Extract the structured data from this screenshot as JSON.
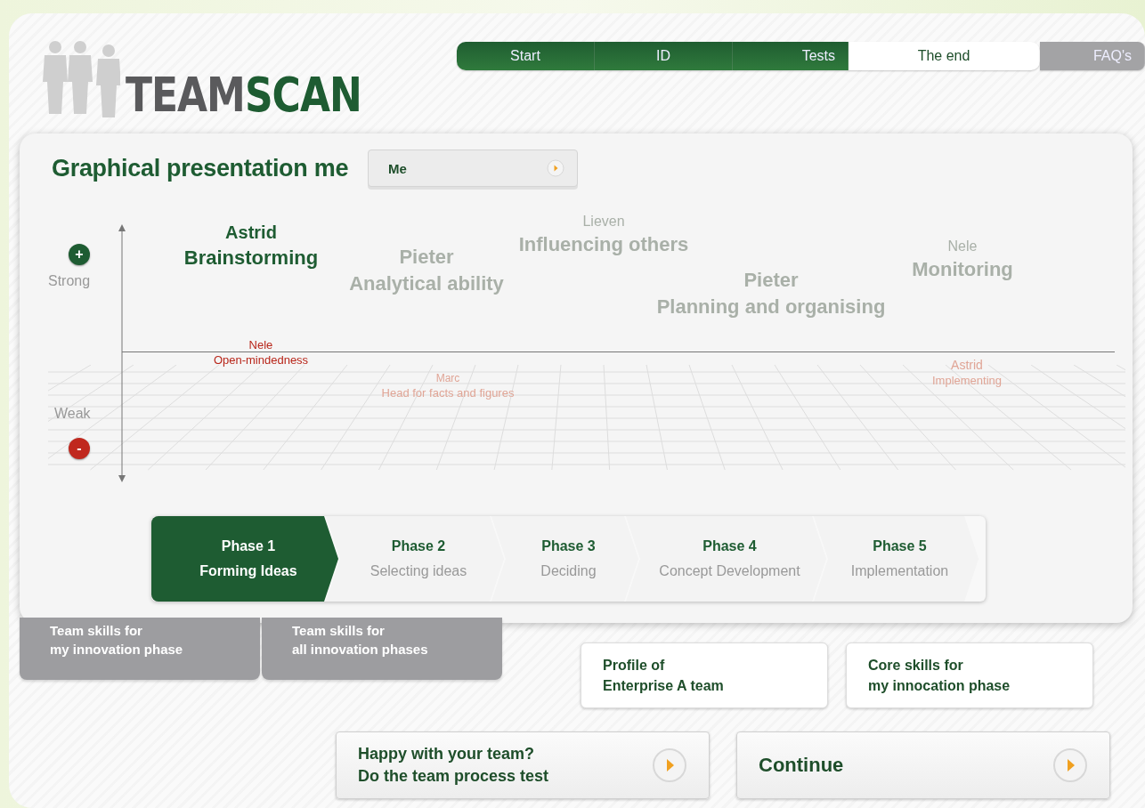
{
  "logo": {
    "text": "TEAMSCAN"
  },
  "nav": [
    {
      "label": "Start",
      "kind": "step",
      "done": true,
      "selected": false
    },
    {
      "label": "ID",
      "kind": "step",
      "done": true,
      "selected": false
    },
    {
      "label": "Tests",
      "kind": "step",
      "done": true,
      "selected": false
    },
    {
      "label": "The end",
      "kind": "step",
      "done": false,
      "selected": true
    },
    {
      "label": "FAQ's",
      "kind": "help",
      "done": false,
      "selected": false
    }
  ],
  "panel": {
    "title": "Graphical presentation me",
    "selector": {
      "value": "Me"
    }
  },
  "axis": {
    "strong_label": "Strong",
    "plus": "+",
    "weak_label": "Weak",
    "minus": "-"
  },
  "skills": [
    {
      "person": "Astrid",
      "skill": "Brainstorming",
      "kind": "strong",
      "highlighted": true
    },
    {
      "person": "Pieter",
      "skill": "Analytical ability",
      "kind": "strong",
      "highlighted": false
    },
    {
      "person": "Lieven",
      "skill": "Influencing others",
      "kind": "strong",
      "highlighted": false
    },
    {
      "person": "Pieter",
      "skill": "Planning and organising",
      "kind": "strong",
      "highlighted": false
    },
    {
      "person": "Nele",
      "skill": "Monitoring",
      "kind": "strong",
      "highlighted": false
    },
    {
      "person": "Nele",
      "skill": "Open-mindedness",
      "kind": "weak",
      "highlighted": true
    },
    {
      "person": "Marc",
      "skill": "Head for facts and figures",
      "kind": "weak",
      "highlighted": false
    },
    {
      "person": "Astrid",
      "skill": "Implementing",
      "kind": "weak",
      "highlighted": false
    }
  ],
  "phases": [
    {
      "number": "Phase 1",
      "name": "Forming Ideas",
      "selected": true
    },
    {
      "number": "Phase 2",
      "name": "Selecting ideas",
      "selected": false
    },
    {
      "number": "Phase 3",
      "name": "Deciding",
      "selected": false
    },
    {
      "number": "Phase 4",
      "name": "Concept Development",
      "selected": false
    },
    {
      "number": "Phase 5",
      "name": "Implementation",
      "selected": false
    }
  ],
  "tabs": [
    {
      "line1": "Team skills for",
      "line2": "my innovation phase",
      "disabled": true
    },
    {
      "line1": "Team skills for",
      "line2": "all innovation phases",
      "disabled": true
    }
  ],
  "options": [
    {
      "line1": "Profile of",
      "line2": "Enterprise A team"
    },
    {
      "line1": "Core skills for",
      "line2": "my innocation phase"
    }
  ],
  "actions": [
    {
      "line1": "Happy with your team?",
      "line2": "Do the team process test"
    },
    {
      "line1": "Continue"
    }
  ]
}
